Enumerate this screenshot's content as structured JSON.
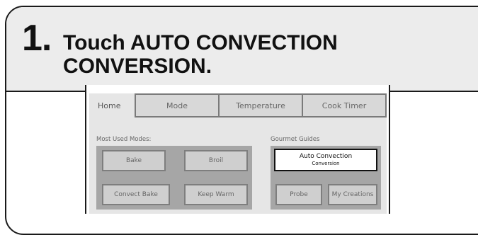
{
  "step": {
    "number": "1.",
    "instruction_line1": "Touch AUTO CONVECTION",
    "instruction_line2": "CONVERSION."
  },
  "tabs": [
    {
      "label": "Home"
    },
    {
      "label": "Mode"
    },
    {
      "label": "Temperature"
    },
    {
      "label": "Cook Timer"
    }
  ],
  "most_used": {
    "title": "Most Used Modes:",
    "buttons": [
      "Bake",
      "Broil",
      "Convect Bake",
      "Keep Warm"
    ]
  },
  "gourmet": {
    "title": "Gourmet Guides",
    "selected_line1": "Auto Convection",
    "selected_line2": "Conversion",
    "buttons": [
      "Probe",
      "My Creations"
    ]
  }
}
